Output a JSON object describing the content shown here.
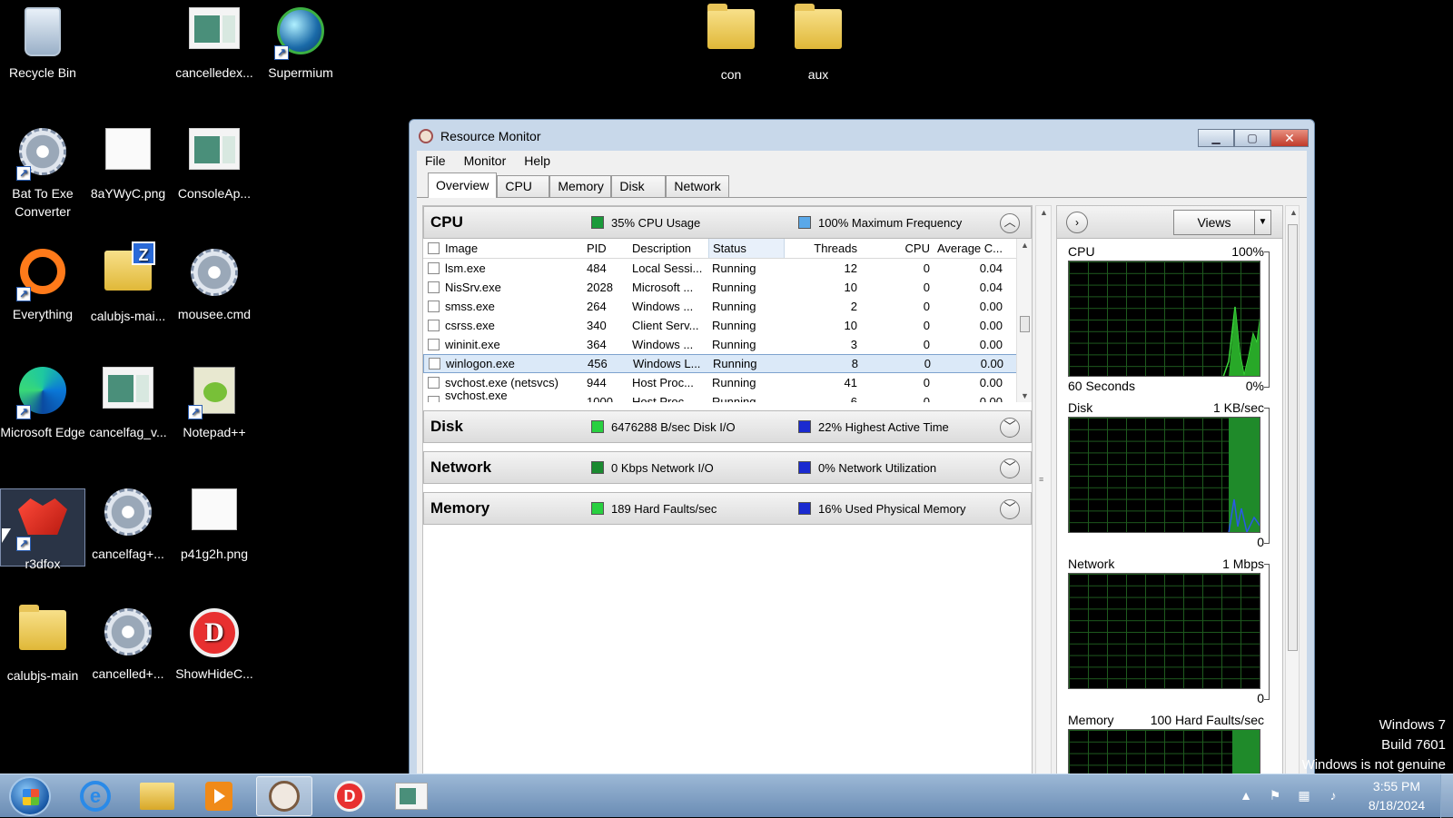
{
  "desktop": {
    "icons": [
      {
        "label": "Recycle Bin"
      },
      {
        "label": "cancelledex..."
      },
      {
        "label": "Supermium"
      },
      {
        "label": "con"
      },
      {
        "label": "aux"
      },
      {
        "label": "Bat To Exe Converter"
      },
      {
        "label": "8aYWyC.png"
      },
      {
        "label": "ConsoleAp..."
      },
      {
        "label": "Everything"
      },
      {
        "label": "calubjs-mai..."
      },
      {
        "label": "mousee.cmd"
      },
      {
        "label": "Microsoft Edge"
      },
      {
        "label": "cancelfag_v..."
      },
      {
        "label": "Notepad++"
      },
      {
        "label": "r3dfox"
      },
      {
        "label": "cancelfag+..."
      },
      {
        "label": "p41g2h.png"
      },
      {
        "label": "calubjs-main"
      },
      {
        "label": "cancelled+..."
      },
      {
        "label": "ShowHideC..."
      }
    ]
  },
  "window": {
    "title": "Resource Monitor",
    "controls": {
      "minimize": "▁",
      "maximize": "▢",
      "close": "✕"
    },
    "menu": [
      "File",
      "Monitor",
      "Help"
    ],
    "tabs": [
      "Overview",
      "CPU",
      "Memory",
      "Disk",
      "Network"
    ],
    "active_tab": "Overview",
    "cpu_section": {
      "name": "CPU",
      "legend1": {
        "text": "35% CPU Usage",
        "color": "#1a9a3a"
      },
      "legend2": {
        "text": "100% Maximum Frequency",
        "color": "#5aa8e8"
      },
      "collapse_glyph": "︿",
      "columns": {
        "image": "Image",
        "pid": "PID",
        "description": "Description",
        "status": "Status",
        "threads": "Threads",
        "cpu": "CPU",
        "avg": "Average C..."
      },
      "rows": [
        {
          "image": "lsm.exe",
          "pid": "484",
          "description": "Local Sessi...",
          "status": "Running",
          "threads": "12",
          "cpu": "0",
          "avg": "0.04"
        },
        {
          "image": "NisSrv.exe",
          "pid": "2028",
          "description": "Microsoft ...",
          "status": "Running",
          "threads": "10",
          "cpu": "0",
          "avg": "0.04"
        },
        {
          "image": "smss.exe",
          "pid": "264",
          "description": "Windows ...",
          "status": "Running",
          "threads": "2",
          "cpu": "0",
          "avg": "0.00"
        },
        {
          "image": "csrss.exe",
          "pid": "340",
          "description": "Client Serv...",
          "status": "Running",
          "threads": "10",
          "cpu": "0",
          "avg": "0.00"
        },
        {
          "image": "wininit.exe",
          "pid": "364",
          "description": "Windows ...",
          "status": "Running",
          "threads": "3",
          "cpu": "0",
          "avg": "0.00"
        },
        {
          "image": "winlogon.exe",
          "pid": "456",
          "description": "Windows L...",
          "status": "Running",
          "threads": "8",
          "cpu": "0",
          "avg": "0.00"
        },
        {
          "image": "svchost.exe (netsvcs)",
          "pid": "944",
          "description": "Host Proc...",
          "status": "Running",
          "threads": "41",
          "cpu": "0",
          "avg": "0.00"
        },
        {
          "image": "svchost.exe (GPSvcGroup)",
          "pid": "1000",
          "description": "Host Proc...",
          "status": "Running",
          "threads": "6",
          "cpu": "0",
          "avg": "0.00"
        }
      ],
      "selected_row": 5
    },
    "disk_section": {
      "name": "Disk",
      "legend1": {
        "text": "6476288 B/sec Disk I/O",
        "color": "#28d040"
      },
      "legend2": {
        "text": "22% Highest Active Time",
        "color": "#1a2ad0"
      },
      "expand_glyph": "﹀"
    },
    "network_section": {
      "name": "Network",
      "legend1": {
        "text": "0 Kbps Network I/O",
        "color": "#1a8a30"
      },
      "legend2": {
        "text": "0% Network Utilization",
        "color": "#1a2ad0"
      },
      "expand_glyph": "﹀"
    },
    "memory_section": {
      "name": "Memory",
      "legend1": {
        "text": "189 Hard Faults/sec",
        "color": "#28d040"
      },
      "legend2": {
        "text": "16% Used Physical Memory",
        "color": "#1a2ad0"
      },
      "expand_glyph": "﹀"
    },
    "graphs_pane": {
      "expand_glyph": "›",
      "views_label": "Views",
      "views_dropdown_glyph": "▼",
      "cpu": {
        "title": "CPU",
        "max": "100%",
        "time": "60 Seconds",
        "min": "0%"
      },
      "disk": {
        "title": "Disk",
        "max": "1 KB/sec",
        "min": "0"
      },
      "network": {
        "title": "Network",
        "max": "1 Mbps",
        "min": "0"
      },
      "memory": {
        "title": "Memory",
        "max": "100 Hard Faults/sec"
      }
    }
  },
  "watermark": {
    "line1": "Windows 7",
    "line2": "Build 7601",
    "line3": "Windows is not genuine"
  },
  "taskbar": {
    "ie_glyph": "e",
    "d_glyph": "D",
    "tray": {
      "chevron": "▲",
      "clock_time": "3:55 PM",
      "clock_date": "8/18/2024"
    }
  },
  "colors": {
    "selected_row_bg": "#dbe9f8",
    "graph_grid": "#1e5a1e",
    "graph_line": "#3cdc3c"
  }
}
